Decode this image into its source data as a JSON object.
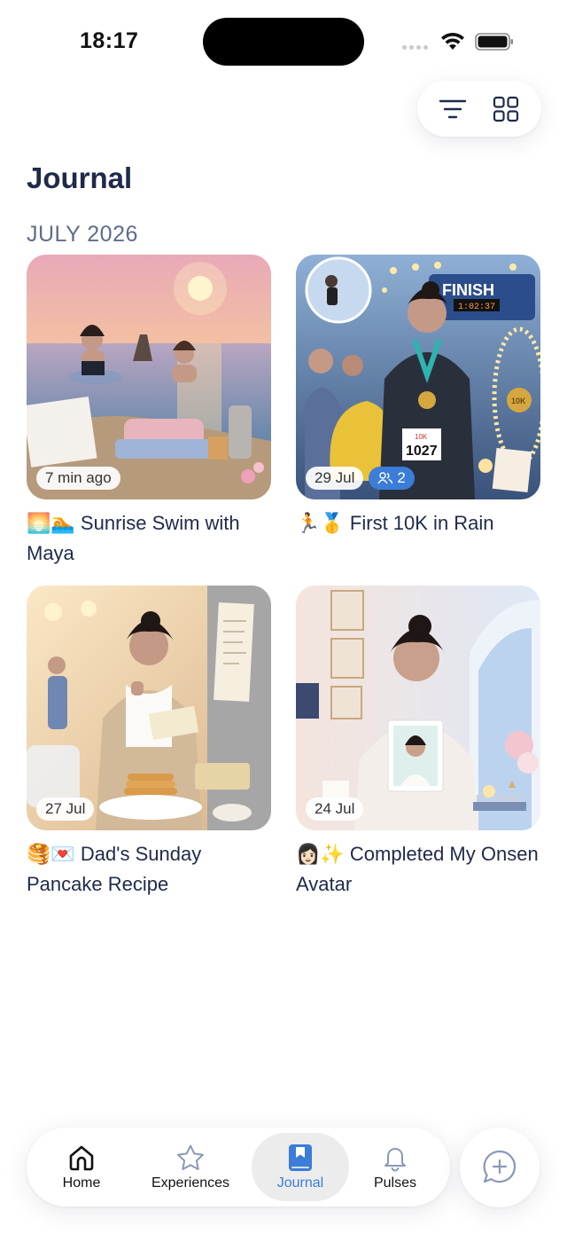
{
  "status_bar": {
    "time": "18:17"
  },
  "toolbar": {
    "filter_icon": "filter-icon",
    "grid_icon": "grid-icon"
  },
  "page": {
    "title": "Journal",
    "section_header": "JULY 2026"
  },
  "entries": [
    {
      "title_emoji": "🌅🏊",
      "title": "Sunrise Swim with Maya",
      "date_badge": "7 min ago",
      "people_count": null,
      "image": "sunrise-swim-illustration"
    },
    {
      "title_emoji": "🏃🥇",
      "title": "First 10K in Rain",
      "date_badge": "29 Jul",
      "people_count": "2",
      "image": "10k-finish-illustration",
      "image_texts": {
        "finish_banner": "FINISH",
        "clock": "1:02:37",
        "bib_top": "10K",
        "bib_number": "1027",
        "medal": "10K"
      }
    },
    {
      "title_emoji": "🥞💌",
      "title": "Dad's Sunday Pancake Recipe",
      "date_badge": "27 Jul",
      "people_count": null,
      "image": "pancake-kitchen-illustration"
    },
    {
      "title_emoji": "👩🏻✨",
      "title": "Completed My Onsen Avatar",
      "date_badge": "24 Jul",
      "people_count": null,
      "image": "avatar-portrait-illustration"
    }
  ],
  "nav": {
    "items": [
      {
        "label": "Home",
        "icon": "home-icon",
        "active": false
      },
      {
        "label": "Experiences",
        "icon": "star-icon",
        "active": false
      },
      {
        "label": "Journal",
        "icon": "journal-icon",
        "active": true
      },
      {
        "label": "Pulses",
        "icon": "bell-icon",
        "active": false
      }
    ],
    "compose_icon": "chat-plus-icon"
  },
  "colors": {
    "accent": "#3b7dd8",
    "title": "#1f2a4a",
    "section": "#5f6d89"
  }
}
